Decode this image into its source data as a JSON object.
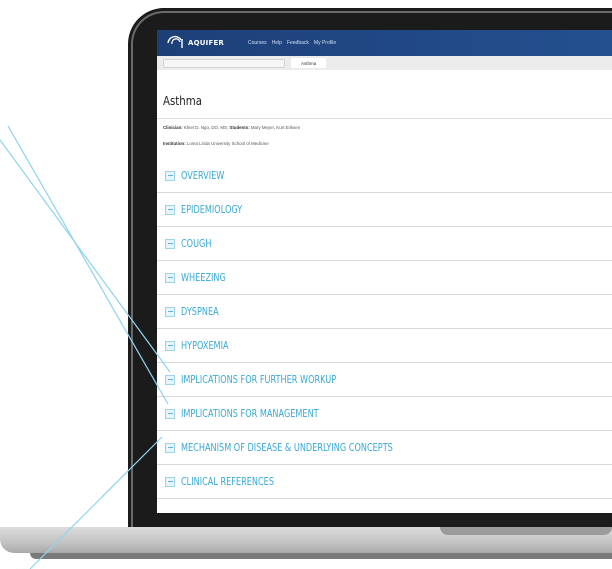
{
  "navbar": {
    "logo_text": "AQUIFER",
    "links": [
      "Courses",
      "Help",
      "Feedback",
      "My Profile"
    ]
  },
  "subbar": {
    "url_text": "",
    "active_case_tab": "Asthma"
  },
  "case": {
    "title": "Asthma",
    "clinician_label": "Clinician:",
    "clinician_value": "Khiet D. Ngo, DO, MS;",
    "students_label": "Students:",
    "students_value": "Mary Meyer, Kurt Eriksen",
    "institution_label": "Institution:",
    "institution_value": "Loma Linda University School of Medicine"
  },
  "sections": [
    "OVERVIEW",
    "EPIDEMIOLOGY",
    "COUGH",
    "WHEEZING",
    "DYSPNEA",
    "HYPOXEMIA",
    "IMPLICATIONS FOR FURTHER WORKUP",
    "IMPLICATIONS FOR MANAGEMENT",
    "MECHANISM OF DISEASE & UNDERLYING CONCEPTS",
    "CLINICAL REFERENCES"
  ],
  "colors": {
    "navbar": "#1d3f78",
    "section_text": "#3aa8d4",
    "callout_line": "#8fd3ee",
    "bezel": "#1b1b1c"
  }
}
